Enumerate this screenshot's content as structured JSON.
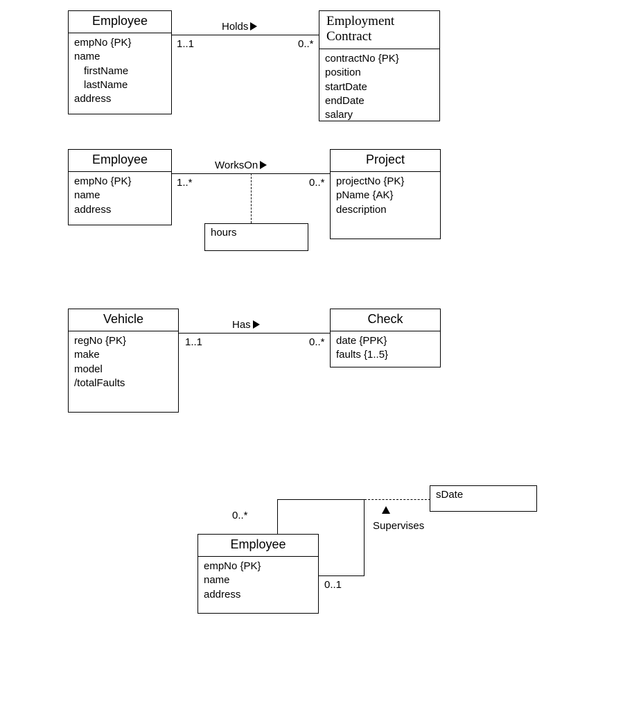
{
  "d1": {
    "left": {
      "title": "Employee",
      "attrs": [
        "empNo {PK}",
        "name",
        "firstName",
        "lastName",
        "address"
      ]
    },
    "right": {
      "title": "Employment Contract",
      "attrs": [
        "contractNo {PK}",
        "position",
        "startDate",
        "endDate",
        "salary"
      ]
    },
    "rel": "Holds",
    "multL": "1..1",
    "multR": "0..*"
  },
  "d2": {
    "left": {
      "title": "Employee",
      "attrs": [
        "empNo {PK}",
        "name",
        "address"
      ]
    },
    "right": {
      "title": "Project",
      "attrs": [
        "projectNo {PK}",
        "pName   {AK}",
        "description"
      ]
    },
    "rel": "WorksOn",
    "multL": "1..*",
    "multR": "0..*",
    "assoc": "hours"
  },
  "d3": {
    "left": {
      "title": "Vehicle",
      "attrs": [
        "regNo {PK}",
        "make",
        "model",
        "/totalFaults"
      ]
    },
    "right": {
      "title": "Check",
      "attrs": [
        "date {PPK}",
        "faults {1..5}"
      ]
    },
    "rel": "Has",
    "multL": "1..1",
    "multR": "0..*"
  },
  "d4": {
    "entity": {
      "title": "Employee",
      "attrs": [
        "empNo {PK}",
        "name",
        "address"
      ]
    },
    "rel": "Supervises",
    "multTop": "0..*",
    "multBot": "0..1",
    "assoc": "sDate"
  }
}
